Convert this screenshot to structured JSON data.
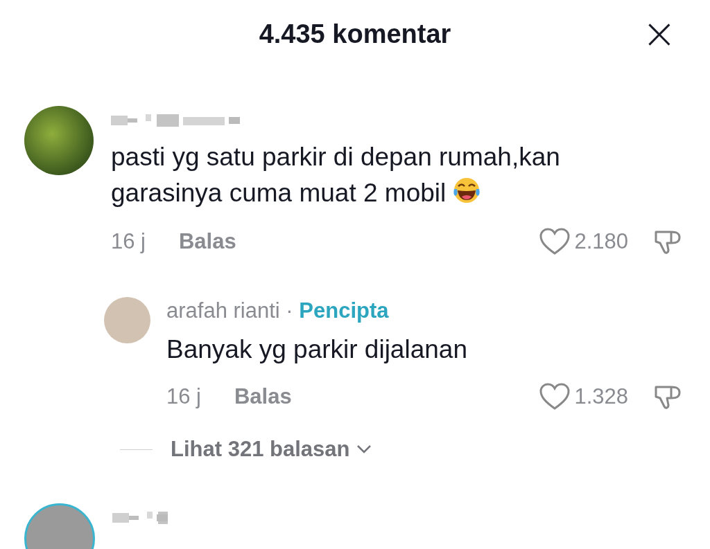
{
  "header": {
    "title": "4.435 komentar",
    "close": "×"
  },
  "comments": [
    {
      "text": "pasti yg satu parkir di depan rumah,kan garasinya cuma muat 2 mobil",
      "time": "16 j",
      "reply_label": "Balas",
      "likes": "2.180",
      "replies": [
        {
          "author": "arafah rianti",
          "separator": "·",
          "badge": "Pencipta",
          "text": "Banyak yg parkir dijalanan",
          "time": "16 j",
          "reply_label": "Balas",
          "likes": "1.328"
        }
      ],
      "view_replies": "Lihat 321 balasan"
    }
  ]
}
